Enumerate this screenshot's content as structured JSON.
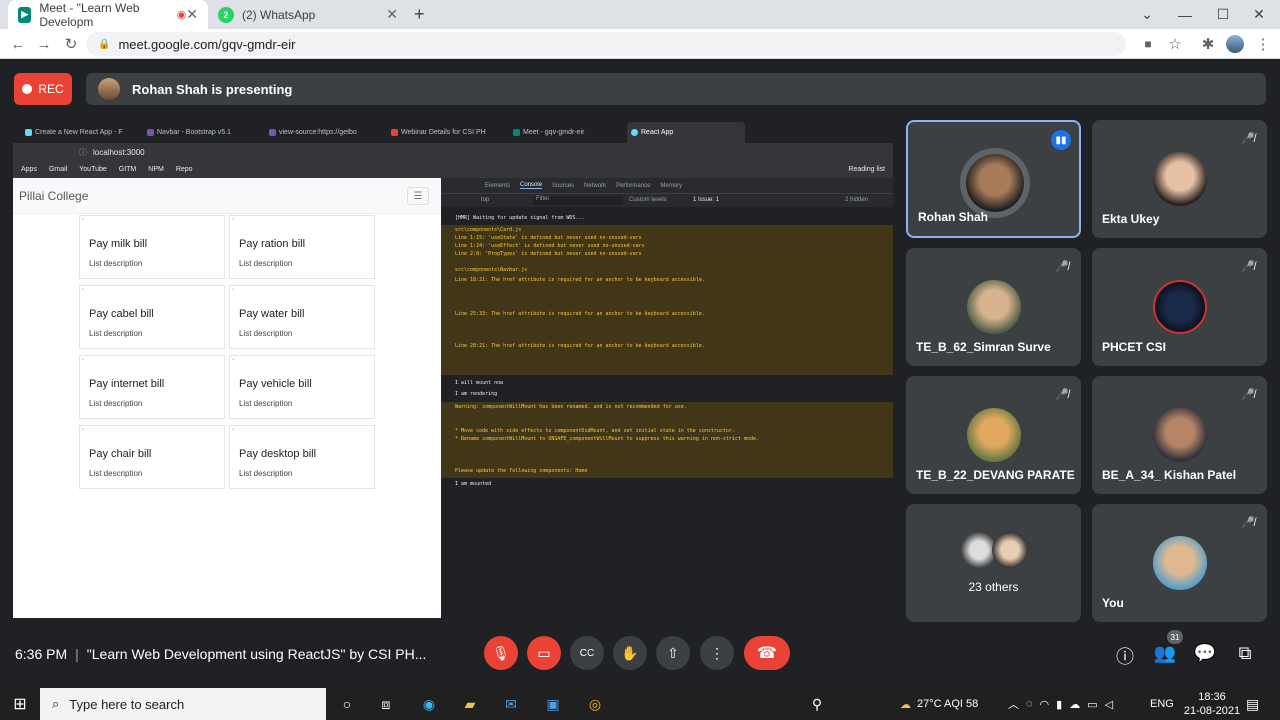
{
  "browser": {
    "tabs": [
      {
        "title": "Meet - \"Learn Web Developm",
        "active": true
      },
      {
        "title": "(2) WhatsApp",
        "active": false
      }
    ],
    "url": "meet.google.com/gqv-gmdr-eir"
  },
  "meet": {
    "rec_label": "REC",
    "presenting_text": "Rohan Shah is presenting",
    "time": "6:36 PM",
    "separator": "|",
    "meeting_title": "\"Learn Web Development using ReactJS\" by CSI PH...",
    "participant_count": "31",
    "tiles": [
      {
        "name": "Rohan Shah",
        "speaking": true
      },
      {
        "name": "Ekta Ukey"
      },
      {
        "name": "TE_B_62_Simran Surve"
      },
      {
        "name": "PHCET CSI"
      },
      {
        "name": "TE_B_22_DEVANG PARATE"
      },
      {
        "name": "BE_A_34_ Kishan Patel"
      },
      {
        "name": "23 others"
      },
      {
        "name": "You"
      }
    ]
  },
  "shared_screen": {
    "tabs": [
      "Create a New React App - F",
      "Navbar - Bootstrap v5.1",
      "view-source:https://getbo",
      "Webinar Details for CSI PH",
      "Meet - gqv-gmdr-eir",
      "React App"
    ],
    "url": "localhost:3000",
    "bookmarks": [
      "Apps",
      "Gmail",
      "YouTube",
      "GITM",
      "NPM",
      "Repo"
    ],
    "reading_list": "Reading list",
    "brand": "Pillai College",
    "cards": [
      {
        "title": "Pay milk bill",
        "desc": "List description"
      },
      {
        "title": "Pay ration bill",
        "desc": "List description"
      },
      {
        "title": "Pay cabel bill",
        "desc": "List description"
      },
      {
        "title": "Pay water bill",
        "desc": "List description"
      },
      {
        "title": "Pay internet bill",
        "desc": "List description"
      },
      {
        "title": "Pay vehicle bill",
        "desc": "List description"
      },
      {
        "title": "Pay chair bill",
        "desc": "List description"
      },
      {
        "title": "Pay desktop bill",
        "desc": "List description"
      }
    ],
    "devtools": {
      "tabs": [
        "Elements",
        "Console",
        "Sources",
        "Network",
        "Performance",
        "Memory"
      ],
      "context": "top",
      "filter_placeholder": "Filter",
      "levels": "Custom levels",
      "issues": "1 Issue: 1",
      "hidden": "2 hidden",
      "lines": [
        "[HMR] Waiting for update signal from WDS...",
        "src\\components\\Card.js",
        "  Line 1:15:  'useState' is defined but never used  no-unused-vars",
        "  Line 1:24:  'useEffect' is defined but never used  no-unused-vars",
        "  Line 2:8:  'PropTypes' is defined but never used  no-unused-vars",
        "src\\components\\Navbar.js",
        "  Line 18:21:  The href attribute is required for an anchor to be keyboard accessible.",
        "  Line 25:33:  The href attribute is required for an anchor to be keyboard accessible.",
        "  Line 28:21:  The href attribute is required for an anchor to be keyboard accessible.",
        "I will mount now",
        "I am rendering",
        "Warning: componentWillMount has been renamed, and is not recommended for use.",
        "* Move code with side effects to componentDidMount, and set initial state in the constructor.",
        "* Rename componentWillMount to UNSAFE_componentWillMount to suppress this warning in non-strict mode.",
        "Please update the following components: Home",
        "I am mounted"
      ]
    }
  },
  "taskbar": {
    "search_placeholder": "Type here to search",
    "weather": "27°C  AQI 58",
    "lang": "ENG",
    "clock_time": "18:36",
    "clock_date": "21-08-2021"
  }
}
